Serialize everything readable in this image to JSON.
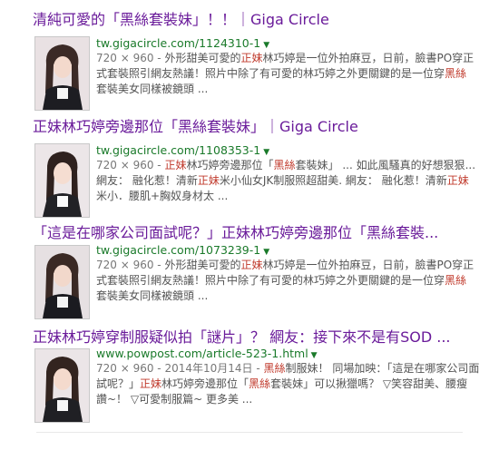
{
  "colors": {
    "title": "#6a1b9a",
    "url": "#1a7a2a",
    "snippet": "#545454",
    "highlight": "#c0392b",
    "meta": "#777777"
  },
  "results": [
    {
      "title": "清純可愛的「黑絲套裝妹」！！｜Giga Circle",
      "url": "tw.gigacircle.com/1124310-1",
      "meta": "720 × 960 - ",
      "line1_a": "外形甜美可愛的",
      "line1_hl": "正妹",
      "line1_b": "林巧婷是一位外拍麻豆，日前，臉書PO穿正",
      "line2_a": "式套裝照引網友熱議！照片中除了有可愛的林巧婷之外更關鍵的是一位穿",
      "line2_hl": "黑絲",
      "line3": "套裝美女同樣被鏡頭 ..."
    },
    {
      "title": "正妹林巧婷旁邊那位「黑絲套裝妹」｜Giga Circle",
      "url": "tw.gigacircle.com/1108353-1",
      "meta": "720 × 960 - ",
      "line1_hl": "正妹",
      "line1_b": "林巧婷旁邊那位「",
      "line1_hl2": "黑絲",
      "line1_c": "套裝妹」 ... 如此風騷真的好想狠狠...",
      "line2_a": "網友： 融化惹！清新",
      "line2_hl": "正妹",
      "line2_b": "米小仙女JK制服照超甜美. 網友： 融化惹！清新",
      "line2_hl2": "正妹",
      "line3": "米小．腰肌+胸奴身材太 ..."
    },
    {
      "title": "「這是在哪家公司面試呢？」正妹林巧婷旁邊那位「黑絲套裝...",
      "url": "tw.gigacircle.com/1073239-1",
      "meta": "720 × 960 - ",
      "line1_a": "外形甜美可愛的",
      "line1_hl": "正妹",
      "line1_b": "林巧婷是一位外拍麻豆，日前，臉書PO穿正",
      "line2_a": "式套裝照引網友熱議！照片中除了有可愛的林巧婷之外更關鍵的是一位穿",
      "line2_hl": "黑絲",
      "line3": "套裝美女同樣被鏡頭 ..."
    },
    {
      "title": "正妹林巧婷穿制服疑似拍「謎片」？ 網友：接下來不是有SOD ...",
      "url": "www.powpost.com/article-523-1.html",
      "meta": "720 × 960 - 2014年10月14日 - ",
      "line1_hl": "黑絲",
      "line1_b": "制服妹！ 同場加映：「這是在哪家公司面",
      "line2_a": "試呢？」",
      "line2_hl": "正妹",
      "line2_b": "林巧婷旁邊那位「",
      "line2_hl2": "黑絲",
      "line2_c": "套裝妹」可以揪獵嗎？ ▽笑容甜美、腰瘦",
      "line3": "讚~！ ▽可愛制服篇~ 更多美 ..."
    }
  ]
}
